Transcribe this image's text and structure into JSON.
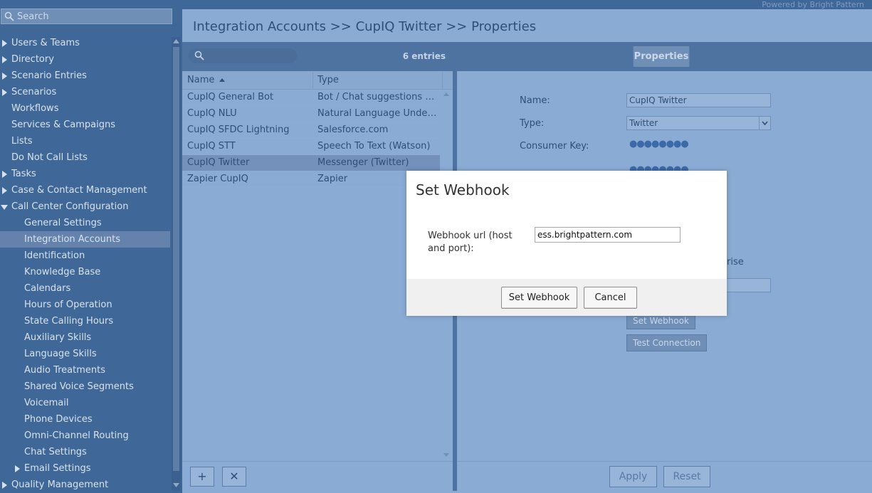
{
  "search": {
    "placeholder": "Search"
  },
  "powered_by": "Powered by Bright Pattern",
  "nav": {
    "users_teams": "Users & Teams",
    "directory": "Directory",
    "scenario_entries": "Scenario Entries",
    "scenarios": "Scenarios",
    "workflows": "Workflows",
    "services_campaigns": "Services & Campaigns",
    "lists": "Lists",
    "do_not_call": "Do Not Call Lists",
    "tasks": "Tasks",
    "case_contact": "Case & Contact Management",
    "call_center_config": "Call Center Configuration",
    "general_settings": "General Settings",
    "integration_accounts": "Integration Accounts",
    "identification": "Identification",
    "knowledge_base": "Knowledge Base",
    "calendars": "Calendars",
    "hours_of_operation": "Hours of Operation",
    "state_calling_hours": "State Calling Hours",
    "auxiliary_skills": "Auxiliary Skills",
    "language_skills": "Language Skills",
    "audio_treatments": "Audio Treatments",
    "shared_voice_segments": "Shared Voice Segments",
    "voicemail": "Voicemail",
    "phone_devices": "Phone Devices",
    "omni_channel_routing": "Omni-Channel Routing",
    "chat_settings": "Chat Settings",
    "email_settings": "Email Settings",
    "quality_management": "Quality Management"
  },
  "page": {
    "title": "Integration Accounts >> CupIQ Twitter >> Properties"
  },
  "list": {
    "entries": "6 entries",
    "col_name": "Name",
    "col_type": "Type",
    "rows": [
      {
        "name": "CupIQ General Bot",
        "type": "Bot / Chat suggestions en..."
      },
      {
        "name": "CupIQ NLU",
        "type": "Natural Language Unders..."
      },
      {
        "name": "CupIQ SFDC Lightning",
        "type": "Salesforce.com"
      },
      {
        "name": "CupIQ STT",
        "type": "Speech To Text (Watson)"
      },
      {
        "name": "CupIQ Twitter",
        "type": "Messenger (Twitter)"
      },
      {
        "name": "Zapier CupIQ",
        "type": "Zapier"
      }
    ],
    "add_label": "+",
    "delete_label": "✕"
  },
  "props": {
    "tab": "Properties",
    "name_label": "Name:",
    "name_value": "CupIQ Twitter",
    "type_label": "Type:",
    "type_value": "Twitter",
    "consumer_key_label": "Consumer Key:",
    "masked": "●●●●●●●●",
    "partial_text": "rise",
    "set_webhook": "Set Webhook",
    "test_connection": "Test Connection",
    "apply": "Apply",
    "reset": "Reset"
  },
  "dialog": {
    "title": "Set Webhook",
    "label": "Webhook url (host and port):",
    "value": "ess.brightpattern.com",
    "ok": "Set Webhook",
    "cancel": "Cancel"
  },
  "colors": {
    "sidebar": "#3f6797",
    "panel": "#8aabd4",
    "toolbar": "#4f73a0",
    "dialog": "#ffffff"
  }
}
